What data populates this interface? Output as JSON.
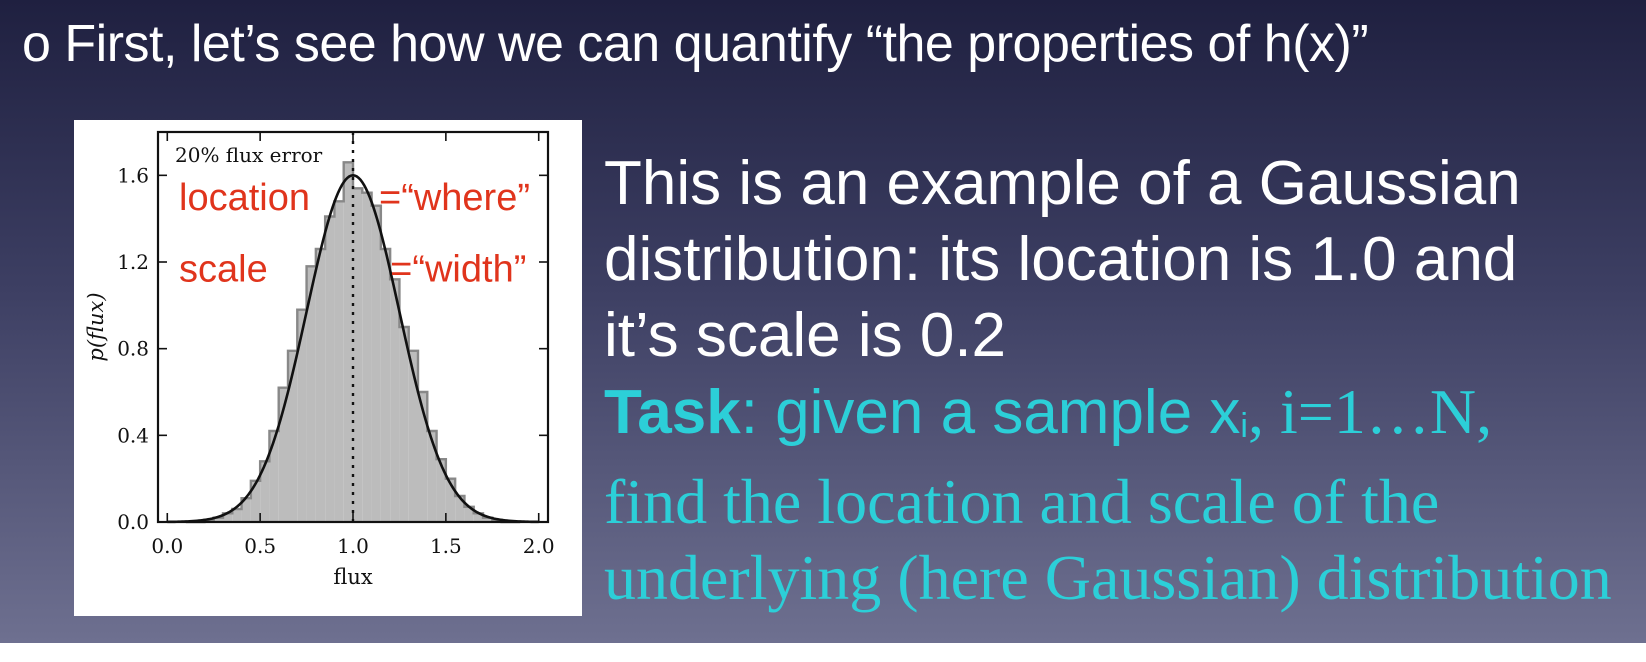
{
  "slide": {
    "bullet": "o",
    "headline": "First, let’s see how we can quantify “the properties of h(x)”",
    "body": {
      "line1": "This is an example of a Gaussian",
      "line2": "distribution: its location is 1.0 and",
      "line3": "it’s scale is 0.2",
      "task_label": "Task",
      "task_sep": ": given a sample x",
      "task_sub": "i",
      "task_rest": ", i=1…N,",
      "line5": "find the location and scale of the",
      "line6": "underlying (here Gaussian) distribution"
    },
    "colors": {
      "accent": "#2ccfd8",
      "annotation": "#e0341c",
      "hist_fill": "#bcbcbc",
      "hist_edge": "#888888"
    }
  },
  "chart_data": {
    "type": "bar",
    "title": "20% flux error",
    "xlabel": "flux",
    "ylabel": "p(flux)",
    "xlim": [
      -0.05,
      2.05
    ],
    "ylim": [
      0.0,
      1.8
    ],
    "xticks": [
      "0.0",
      "0.5",
      "1.0",
      "1.5",
      "2.0"
    ],
    "yticks": [
      "0.0",
      "0.4",
      "0.8",
      "1.2",
      "1.6"
    ],
    "annotations": {
      "location": "location",
      "location_eq": "=“where”",
      "scale": "scale",
      "scale_eq": "=“width”"
    },
    "histogram": {
      "bin_edges": [
        0.1,
        0.15,
        0.2,
        0.25,
        0.3,
        0.35,
        0.4,
        0.45,
        0.5,
        0.55,
        0.6,
        0.65,
        0.7,
        0.75,
        0.8,
        0.85,
        0.9,
        0.95,
        1.0,
        1.05,
        1.1,
        1.15,
        1.2,
        1.25,
        1.3,
        1.35,
        1.4,
        1.45,
        1.5,
        1.55,
        1.6,
        1.65,
        1.7,
        1.75,
        1.8,
        1.85,
        1.9
      ],
      "values": [
        0.0,
        0.0,
        0.01,
        0.02,
        0.04,
        0.06,
        0.11,
        0.19,
        0.28,
        0.42,
        0.62,
        0.79,
        0.98,
        1.18,
        1.26,
        1.41,
        1.48,
        1.66,
        1.54,
        1.52,
        1.46,
        1.26,
        1.12,
        0.9,
        0.79,
        0.6,
        0.42,
        0.29,
        0.2,
        0.12,
        0.07,
        0.04,
        0.02,
        0.01,
        0.0,
        0.0
      ]
    },
    "gaussian": {
      "mean": 1.0,
      "sigma": 0.25,
      "peak": 1.6,
      "x_from": 0.0,
      "x_to": 2.0
    },
    "vline_x": 1.0
  }
}
